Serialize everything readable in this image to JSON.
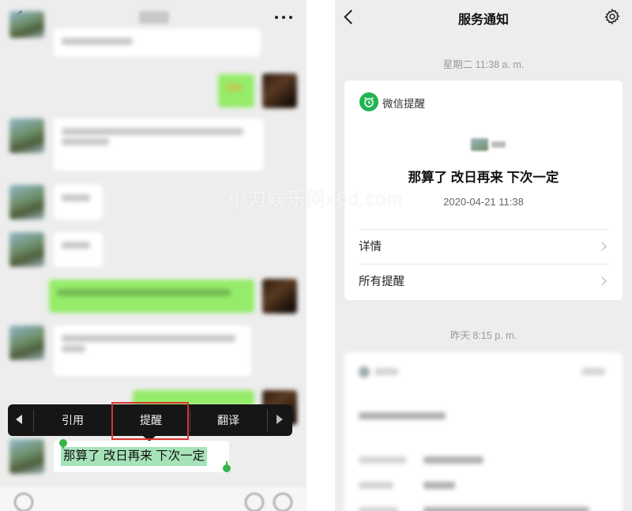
{
  "left_panel": {
    "context_menu": {
      "items": [
        "引用",
        "提醒",
        "翻译"
      ],
      "highlighted_item": "提醒",
      "highlight_color": "#d8342f"
    },
    "selected_message": "那算了 改日再来 下次一定",
    "selection_color": "#a7e3b9",
    "accent_green": "#95ec69"
  },
  "right_panel": {
    "title": "服务通知",
    "timestamp_1": "星期二 11:38 a. m.",
    "card": {
      "brand": "微信提醒",
      "brand_color": "#21b553",
      "message": "那算了 改日再来 下次一定",
      "datetime": "2020-04-21 11:38",
      "rows": [
        "详情",
        "所有提醒"
      ]
    },
    "timestamp_2": "昨天 8:15 p. m."
  },
  "watermark": "小刀娱乐网x6d.com",
  "icons": {
    "left_back": "back-icon",
    "left_more": "more-icon",
    "right_back": "back-icon",
    "right_settings": "gear-icon",
    "card_brand": "alarm-clock-icon"
  }
}
